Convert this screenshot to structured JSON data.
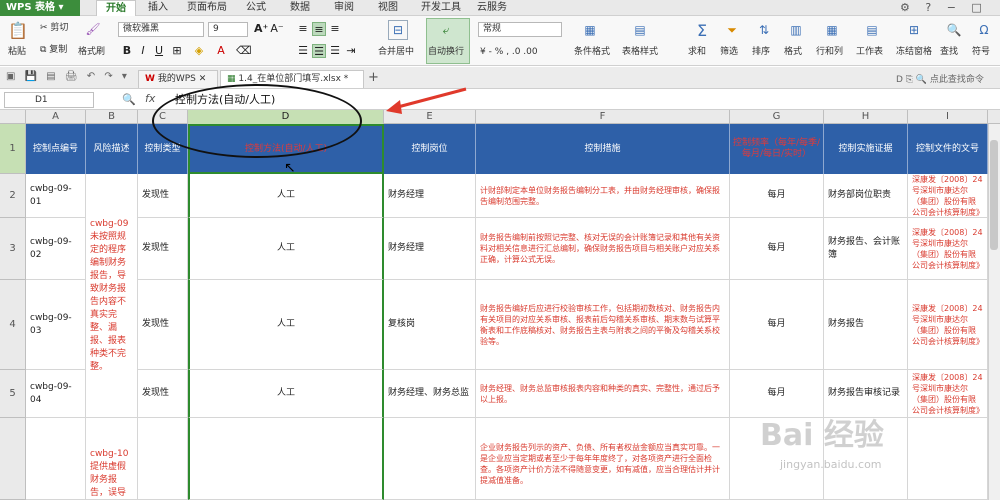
{
  "app": {
    "title": "WPS 表格"
  },
  "menu": [
    "开始",
    "插入",
    "页面布局",
    "公式",
    "数据",
    "审阅",
    "视图",
    "开发工具",
    "云服务"
  ],
  "ribbon": {
    "paste": "粘贴",
    "cut": "剪切",
    "copy": "复制",
    "format_painter": "格式刷",
    "font_name": "微软雅黑",
    "font_size": "9",
    "merge": "合并居中",
    "wrap": "自动换行",
    "number_format": "常规",
    "cond_format": "条件格式",
    "table_style": "表格样式",
    "sum": "求和",
    "filter": "筛选",
    "sort": "排序",
    "format": "格式",
    "rowcol": "行和列",
    "sheet": "工作表",
    "freeze": "冻结窗格",
    "find": "查找",
    "symbol": "符号",
    "search_cmd": "点此查找命令"
  },
  "tabs": {
    "wps": "我的WPS",
    "file": "1.4_在单位部门填写.xlsx *",
    "add": "+"
  },
  "formula": {
    "namebox": "D1",
    "fx": "fx",
    "content": "控制方法(自动/人工)"
  },
  "columns": [
    "A",
    "B",
    "C",
    "D",
    "E",
    "F",
    "G",
    "H",
    "I"
  ],
  "header_row": {
    "row": "1",
    "cells": [
      "控制点编号",
      "风险描述",
      "控制类型",
      "控制方法(自动/人工)",
      "控制岗位",
      "控制措施",
      "控制频率（每年/每季/每月/每日/实时）",
      "控制实施证据",
      "控制文件的文号"
    ]
  },
  "rows": [
    {
      "row": "2",
      "a": "cwbg-09-01",
      "c": "发现性",
      "d": "人工",
      "e": "财务经理",
      "f": "计财部制定本单位财务报告编制分工表，并由财务经理审核，确保报告编制范围完整。",
      "g": "每月",
      "h": "财务部岗位职责",
      "i": "深康发〔2008〕24号深圳市康达尔（集团）股份有限公司会计核算制度》"
    },
    {
      "row": "3",
      "a": "cwbg-09-02",
      "c": "发现性",
      "d": "人工",
      "e": "财务经理",
      "f": "财务报告编制前按照记完整、核对无误的会计账簿记录和其他有关资料对相关信息进行汇总编制，确保财务报告项目与相关账户对应关系正确，计算公式无误。",
      "g": "每月",
      "h": "财务报告、会计账簿",
      "i": "深康发〔2008〕24号深圳市康达尔（集团）股份有限公司会计核算制度》"
    },
    {
      "row": "4",
      "a": "cwbg-09-03",
      "c": "发现性",
      "d": "人工",
      "e": "复核岗",
      "f": "财务报告编好后应进行校验审核工作，包括期初数核对、财务报告内有关项目的对应关系审核、报表前后勾稽关系审核、期末数与试算平衡表和工作底稿核对、财务报告主表与附表之间的平衡及勾稽关系校验等。",
      "g": "每月",
      "h": "财务报告",
      "i": "深康发〔2008〕24号深圳市康达尔（集团）股份有限公司会计核算制度》"
    },
    {
      "row": "5",
      "a": "cwbg-09-04",
      "c": "发现性",
      "d": "人工",
      "e": "财务经理、财务总监",
      "f": "财务经理、财务总监审核报表内容和种类的真实、完整性，通过后予以上报。",
      "g": "每月",
      "h": "财务报告审核记录",
      "i": "深康发〔2008〕24号深圳市康达尔（集团）股份有限公司会计核算制度》"
    },
    {
      "row": "",
      "a": "",
      "c": "",
      "d": "",
      "e": "",
      "f": "企业财务报告列示的资产、负债、所有者权益金额应当真实可靠。一是企业应当定期或者至少于每年年度终了，对各项资产进行全面检查。各项资产计价方法不得随意变更，如有减值，应当合理估计并计提减值准备。",
      "g": "",
      "h": "",
      "i": ""
    }
  ],
  "risk_b1": "cwbg-09未按照规定的程序编制财务报告，导致财务报告内容不真实完整、漏报、报表种类不完整。",
  "risk_b2": "cwbg-10提供虚假财务报告，误导财务报",
  "watermark": {
    "brand": "Bai 经验",
    "url": "jingyan.baidu.com"
  },
  "colors": {
    "header_bg": "#2e60a8",
    "accent_green": "#3c8d3c",
    "risk_text": "#d93a2e",
    "selection": "#c6e0b4"
  }
}
